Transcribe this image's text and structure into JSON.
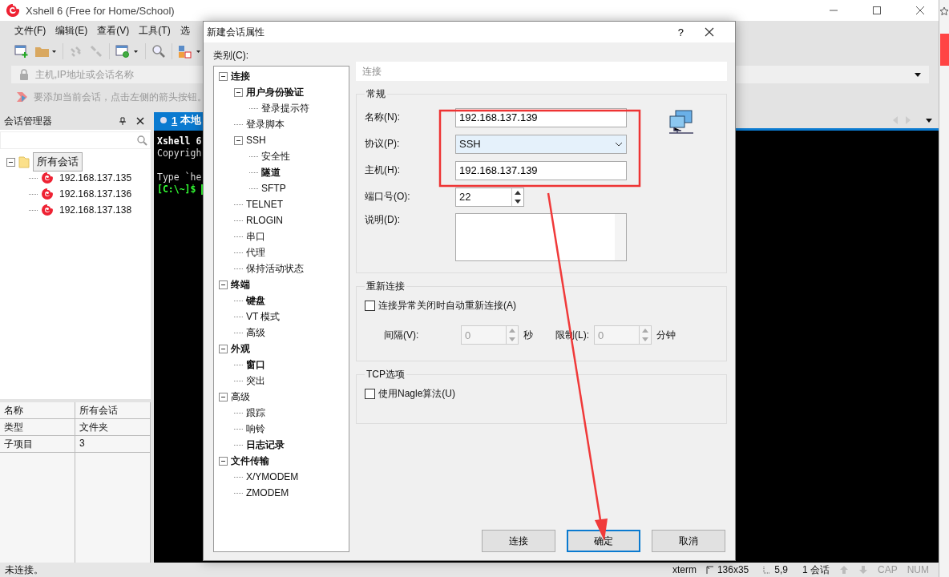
{
  "window": {
    "title": "Xshell 6 (Free for Home/School)"
  },
  "menu": [
    "文件(F)",
    "编辑(E)",
    "查看(V)",
    "工具(T)",
    "选"
  ],
  "address_bar": {
    "placeholder": "主机,IP地址或会话名称"
  },
  "hint_bar": "要添加当前会话，点击左侧的箭头按钮。",
  "session_manager": {
    "title": "会话管理器",
    "tree": [
      {
        "label": "所有会话",
        "kind": "folder",
        "selected": true,
        "expanded": true,
        "children": [
          {
            "label": "192.168.137.135",
            "kind": "session",
            "selected": false
          },
          {
            "label": "192.168.137.136",
            "kind": "session",
            "selected": false
          },
          {
            "label": "192.168.137.138",
            "kind": "session",
            "selected": false
          }
        ]
      }
    ],
    "properties": [
      {
        "name": "名称",
        "value": "所有会话"
      },
      {
        "name": "类型",
        "value": "文件夹"
      },
      {
        "name": "子项目",
        "value": "3"
      }
    ]
  },
  "terminal": {
    "tab": {
      "number": "1",
      "label": "本地"
    },
    "lines": [
      {
        "text": "Xshell 6",
        "kind": "bold",
        "gap_before": false
      },
      {
        "text": "Copyrigh",
        "kind": "plain",
        "gap_before": false
      },
      {
        "text": "Type `he",
        "kind": "plain",
        "gap_before": true
      },
      {
        "text": "[C:\\~]$",
        "kind": "prompt",
        "gap_before": false
      }
    ]
  },
  "dialog": {
    "title": "新建会话属性",
    "help": "?",
    "category_label": "类别(C):",
    "tree": [
      {
        "label": "连接",
        "bold": true,
        "expanded": true,
        "children": [
          {
            "label": "用户身份验证",
            "bold": true,
            "expanded": true,
            "children": [
              {
                "label": "登录提示符",
                "bold": false
              }
            ]
          },
          {
            "label": "登录脚本",
            "bold": false
          },
          {
            "label": "SSH",
            "bold": false,
            "expanded": true,
            "children": [
              {
                "label": "安全性",
                "bold": false
              },
              {
                "label": "隧道",
                "bold": true
              },
              {
                "label": "SFTP",
                "bold": false
              }
            ]
          },
          {
            "label": "TELNET",
            "bold": false
          },
          {
            "label": "RLOGIN",
            "bold": false
          },
          {
            "label": "串口",
            "bold": false
          },
          {
            "label": "代理",
            "bold": false
          },
          {
            "label": "保持活动状态",
            "bold": false
          }
        ]
      },
      {
        "label": "终端",
        "bold": true,
        "expanded": true,
        "children": [
          {
            "label": "键盘",
            "bold": true
          },
          {
            "label": "VT 模式",
            "bold": false
          },
          {
            "label": "高级",
            "bold": false
          }
        ]
      },
      {
        "label": "外观",
        "bold": true,
        "expanded": true,
        "children": [
          {
            "label": "窗口",
            "bold": true
          },
          {
            "label": "突出",
            "bold": false
          }
        ]
      },
      {
        "label": "高级",
        "bold": false,
        "expanded": true,
        "children": [
          {
            "label": "跟踪",
            "bold": false
          },
          {
            "label": "响铃",
            "bold": false
          },
          {
            "label": "日志记录",
            "bold": true
          }
        ]
      },
      {
        "label": "文件传输",
        "bold": true,
        "expanded": true,
        "children": [
          {
            "label": "X/YMODEM",
            "bold": false
          },
          {
            "label": "ZMODEM",
            "bold": false
          }
        ]
      }
    ],
    "section_header": "连接",
    "general": {
      "title": "常规",
      "name": {
        "label": "名称(N):",
        "value": "192.168.137.139"
      },
      "protocol": {
        "label": "协议(P):",
        "value": "SSH"
      },
      "host": {
        "label": "主机(H):",
        "value": "192.168.137.139"
      },
      "port": {
        "label": "端口号(O):",
        "value": "22"
      },
      "description": {
        "label": "说明(D):"
      }
    },
    "reconnect": {
      "title": "重新连接",
      "checkbox": {
        "label": "连接异常关闭时自动重新连接(A)",
        "checked": false
      },
      "interval": {
        "label": "间隔(V):",
        "value": "0",
        "unit": "秒",
        "disabled": true
      },
      "limit": {
        "label": "限制(L):",
        "value": "0",
        "unit": "分钟",
        "disabled": true
      }
    },
    "tcp": {
      "title": "TCP选项",
      "checkbox": {
        "label": "使用Nagle算法(U)",
        "checked": false
      }
    },
    "buttons": [
      {
        "label": "连接",
        "default": false
      },
      {
        "label": "确定",
        "default": true
      },
      {
        "label": "取消",
        "default": false
      }
    ]
  },
  "status_bar": {
    "message": "未连接。",
    "terminal_type": "xterm",
    "size": "136x35",
    "cursor": "5,9",
    "sessions": "1 会话",
    "caps": "CAP",
    "num": "NUM"
  }
}
